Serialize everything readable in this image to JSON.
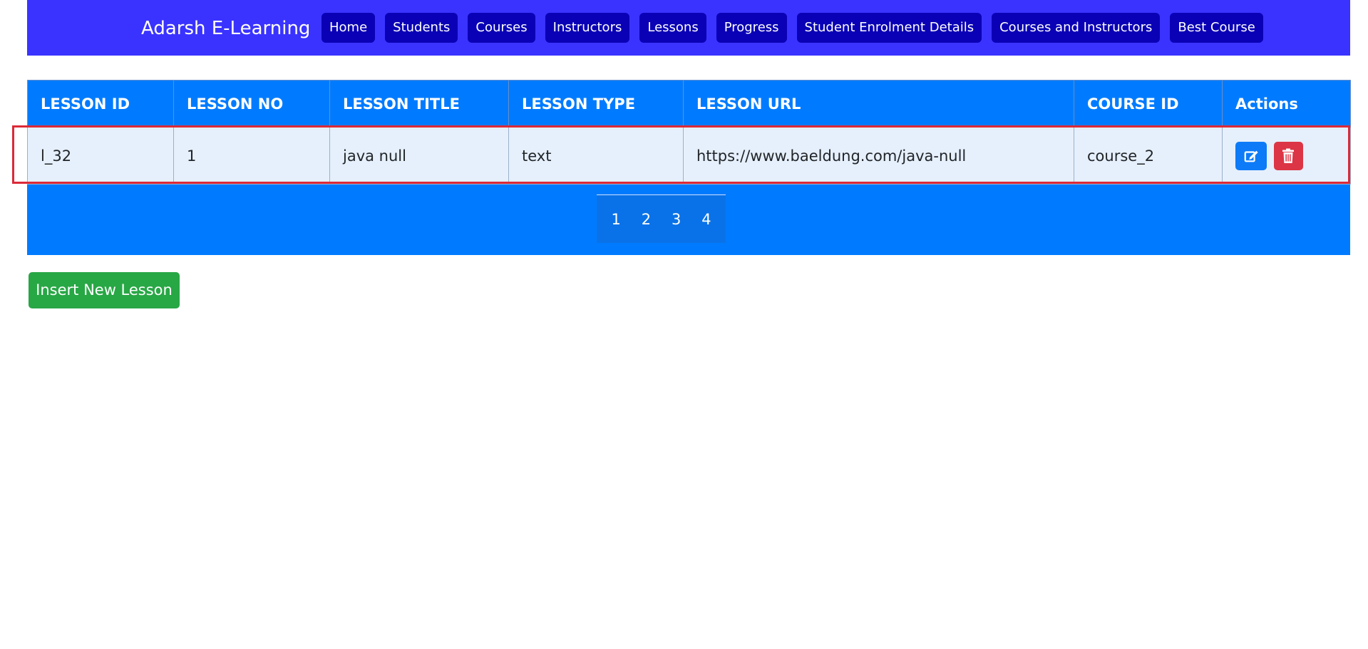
{
  "navbar": {
    "brand": "Adarsh E-Learning",
    "links": [
      {
        "label": "Home"
      },
      {
        "label": "Students"
      },
      {
        "label": "Courses"
      },
      {
        "label": "Instructors"
      },
      {
        "label": "Lessons"
      },
      {
        "label": "Progress"
      },
      {
        "label": "Student Enrolment Details"
      },
      {
        "label": "Courses and Instructors"
      },
      {
        "label": "Best Course"
      }
    ]
  },
  "table": {
    "headers": [
      "LESSON ID",
      "LESSON NO",
      "LESSON TITLE",
      "LESSON TYPE",
      "LESSON URL",
      "COURSE ID",
      "Actions"
    ],
    "rows": [
      {
        "lesson_id": "l_32",
        "lesson_no": "1",
        "lesson_title": "java null",
        "lesson_type": "text",
        "lesson_url": "https://www.baeldung.com/java-null",
        "course_id": "course_2"
      }
    ],
    "actions": {
      "edit_icon": "edit-icon",
      "delete_icon": "trash-icon"
    }
  },
  "pagination": {
    "pages": [
      "1",
      "2",
      "3",
      "4"
    ]
  },
  "insert_button": {
    "label": "Insert New Lesson"
  },
  "colors": {
    "navbar_bg": "#3a33ff",
    "nav_button_bg": "#0a00b5",
    "table_bg": "#007bff",
    "row_bg": "#e6f0fc",
    "highlight_border": "#dc2a38",
    "edit_button": "#0d7bf7",
    "delete_button": "#dc3545",
    "insert_button": "#28a745"
  }
}
